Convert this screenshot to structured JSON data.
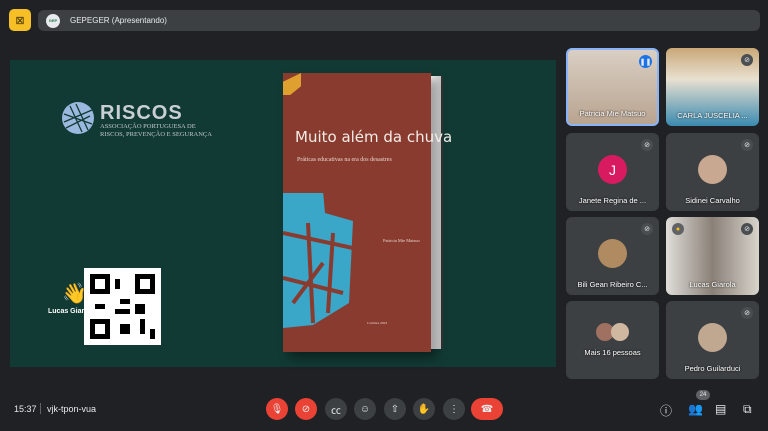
{
  "header": {
    "presenting_title": "GEPEGER (Apresentando)",
    "logo_text": "GEPEGER"
  },
  "slide": {
    "org_name": "RISCOS",
    "org_subtitle": "ASSOCIAÇÃO PORTUGUESA DE RISCOS, PREVENÇÃO E SEGURANÇA",
    "book_title": "Muito além da chuva",
    "book_subtitle": "Práticas educativas na era dos desastres",
    "book_author": "Patricia Mie Matsuo",
    "book_publisher": "Coimbra 2023",
    "raised_hand_name": "Lucas Giarola"
  },
  "participants": [
    {
      "name": "Patricia Mie Matsuo",
      "speaking": true
    },
    {
      "name": "CARLA JUSCELIA ..."
    },
    {
      "name": "Janete Regina de ...",
      "initial": "J",
      "color": "#d81b60"
    },
    {
      "name": "Sidinei Carvalho"
    },
    {
      "name": "Bili Gean Ribeiro C..."
    },
    {
      "name": "Lucas Giarola",
      "hand_raised": true
    },
    {
      "name": "Mais 16 pessoas"
    },
    {
      "name": "Pedro Guilarduci"
    }
  ],
  "footer": {
    "time": "15:37",
    "meeting_code": "vjk-tpon-vua",
    "participant_count": "24"
  },
  "colors": {
    "end_call": "#ea4335",
    "accent": "#8ab4f8",
    "stage": "#123a34"
  }
}
